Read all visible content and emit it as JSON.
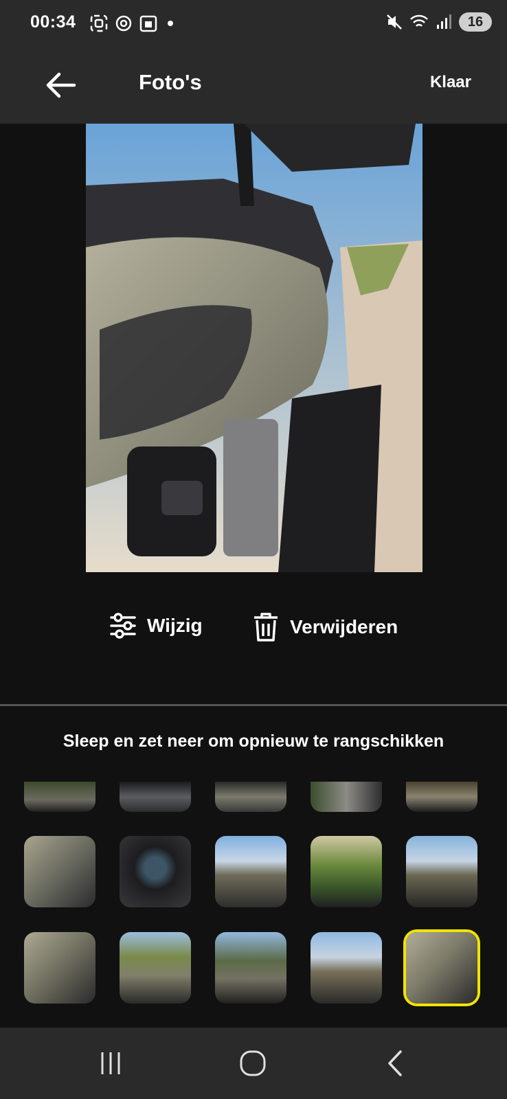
{
  "status_bar": {
    "time": "00:34",
    "battery": "16",
    "icons_left": [
      "screenshot-icon",
      "threads-icon",
      "calendar-icon"
    ],
    "icons_right": [
      "mute-icon",
      "wifi-icon",
      "signal-icon"
    ]
  },
  "app_bar": {
    "title": "Foto's",
    "done_label": "Klaar"
  },
  "actions": {
    "edit_label": "Wijzig",
    "delete_label": "Verwijderen"
  },
  "reorder_hint": "Sleep en zet neer om opnieuw te rangschikken",
  "thumbnails": {
    "selected_index": 14,
    "count": 15
  },
  "colors": {
    "background": "#111111",
    "bar": "#2a2a2a",
    "selection": "#f2e300"
  }
}
